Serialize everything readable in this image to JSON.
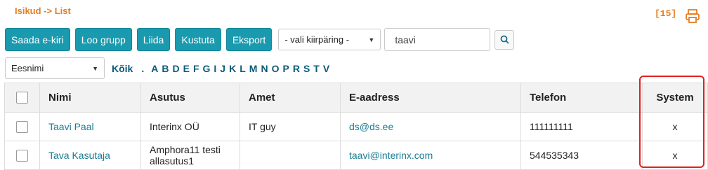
{
  "breadcrumb": "Isikud -> List",
  "count_badge": "[15]",
  "print_icon": "printer-icon",
  "toolbar": {
    "buttons": [
      "Saada e-kiri",
      "Loo grupp",
      "Liida",
      "Kustuta",
      "Eksport"
    ],
    "quick_select": "- vali kiirpäring -",
    "search_value": "taavi"
  },
  "filter": {
    "field_select": "Eesnimi",
    "all_label": "Kõik",
    "dot": ".",
    "letters": [
      "A",
      "B",
      "D",
      "E",
      "F",
      "G",
      "I",
      "J",
      "K",
      "L",
      "M",
      "N",
      "O",
      "P",
      "R",
      "S",
      "T",
      "V"
    ]
  },
  "table": {
    "headers": [
      "Nimi",
      "Asutus",
      "Amet",
      "E-aadress",
      "Telefon",
      "System"
    ],
    "rows": [
      {
        "name": "Taavi Paal",
        "org": "Interinx OÜ",
        "title": "IT guy",
        "email": "ds@ds.ee",
        "phone": "111111111",
        "system": "x"
      },
      {
        "name": "Tava Kasutaja",
        "org": "Amphora11 testi allasutus1",
        "title": "",
        "email": "taavi@interinx.com",
        "phone": "544535343",
        "system": "x"
      }
    ]
  },
  "colors": {
    "accent": "#1a9aaf",
    "orange": "#e67e22",
    "link": "#1a7c93",
    "highlight": "#e02020"
  }
}
